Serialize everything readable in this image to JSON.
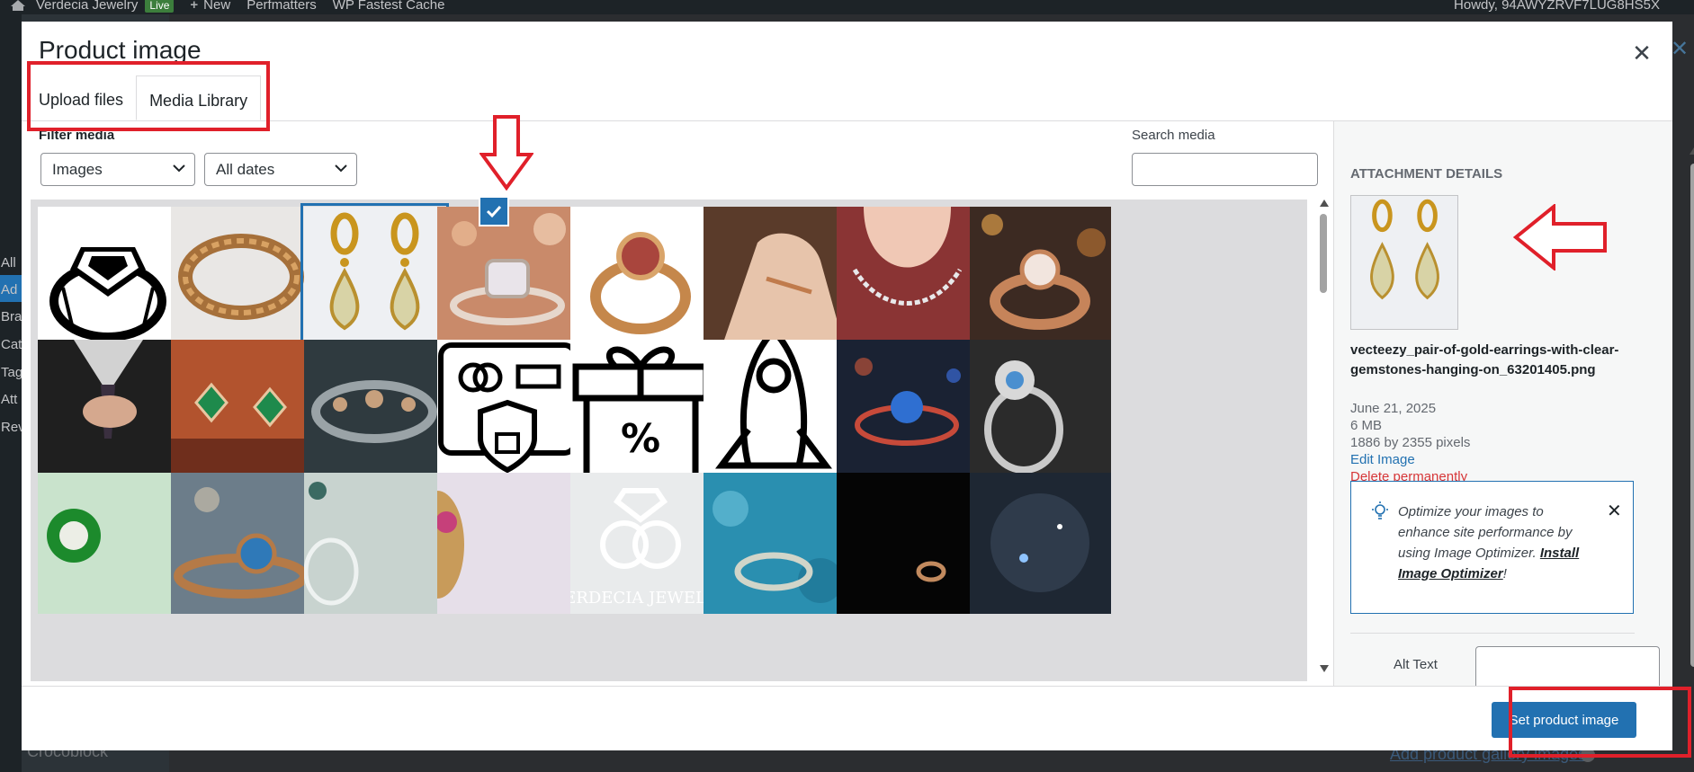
{
  "admin_bar": {
    "site_name": "Verdecia Jewelry",
    "live_badge": "Live",
    "new_label": "New",
    "items": [
      "Perfmatters",
      "WP Fastest Cache"
    ],
    "greeting": "Howdy, 94AWYZRVF7LUG8HS5X"
  },
  "background": {
    "menu_fragments": [
      "All",
      "Ad",
      "Bra",
      "Cat",
      "Tag",
      "Att",
      "Rev"
    ],
    "crocoblock": "Crocoblock",
    "gallery_link": "Add product gallery images"
  },
  "modal": {
    "title": "Product image",
    "tabs": [
      {
        "label": "Upload files",
        "active": false
      },
      {
        "label": "Media Library",
        "active": true
      }
    ],
    "filter_label": "Filter media",
    "filters": {
      "type": {
        "selected": "Images"
      },
      "date": {
        "selected": "All dates"
      }
    },
    "search": {
      "label": "Search media",
      "value": "",
      "placeholder": ""
    },
    "grid": {
      "items": [
        {
          "name": "ring-line-icon",
          "selected": false
        },
        {
          "name": "twisted-gold-ring",
          "selected": false
        },
        {
          "name": "gold-drop-earrings",
          "selected": true
        },
        {
          "name": "diamond-ring-bokeh",
          "selected": false
        },
        {
          "name": "red-gem-gold-ring",
          "selected": false
        },
        {
          "name": "hand-with-ring",
          "selected": false
        },
        {
          "name": "diamond-necklace",
          "selected": false
        },
        {
          "name": "rose-gold-ring-bokeh",
          "selected": false
        },
        {
          "name": "man-in-suit-ring",
          "selected": false
        },
        {
          "name": "emerald-earrings",
          "selected": false
        },
        {
          "name": "ornate-silver-bracelet",
          "selected": false
        },
        {
          "name": "secure-payment-icon",
          "selected": false
        },
        {
          "name": "gift-discount-icon",
          "selected": false
        },
        {
          "name": "rocket-icon",
          "selected": false
        },
        {
          "name": "blue-gem-ring-bokeh",
          "selected": false
        },
        {
          "name": "silver-halo-ring",
          "selected": false
        },
        {
          "name": "emerald-halo-ring",
          "selected": false
        },
        {
          "name": "blue-stone-ring",
          "selected": false
        },
        {
          "name": "silver-ring-pale",
          "selected": false
        },
        {
          "name": "pink-gem-ring",
          "selected": false
        },
        {
          "name": "verdecia-logo",
          "selected": false
        },
        {
          "name": "ring-on-blue-glitter",
          "selected": false
        },
        {
          "name": "ring-in-dark",
          "selected": false
        },
        {
          "name": "dark-sparkle-ring",
          "selected": false
        }
      ]
    },
    "details": {
      "heading": "Attachment Details",
      "filename": "vecteezy_pair-of-gold-earrings-with-clear-gemstones-hanging-on_63201405.png",
      "date": "June 21, 2025",
      "size": "6 MB",
      "dimensions": "1886 by 2355 pixels",
      "edit_link": "Edit Image",
      "delete_link": "Delete permanently",
      "notice": {
        "text": "Optimize your images to enhance site performance by using Image Optimizer.",
        "link": "Install Image Optimizer",
        "suffix": "!"
      },
      "alt_text_label": "Alt Text",
      "alt_text_value": ""
    },
    "primary_button": "Set product image",
    "logo_text": "VERDECIA JEWELRY"
  },
  "colors": {
    "primary": "#2271b1",
    "danger": "#d63638",
    "annotation": "#e0202a"
  }
}
